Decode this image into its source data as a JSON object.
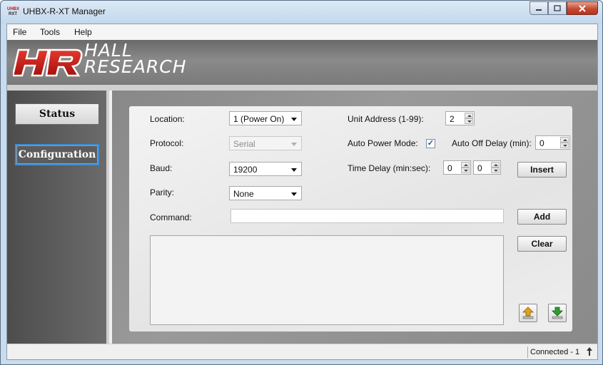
{
  "window": {
    "title": "UHBX-R-XT Manager",
    "app_icon_top": "UHBX",
    "app_icon_bottom": "RXT"
  },
  "menu": {
    "items": [
      "File",
      "Tools",
      "Help"
    ]
  },
  "banner": {
    "logo_mark": "HR",
    "brand_line1": "HALL",
    "brand_line2": "RESEARCH"
  },
  "nav": {
    "status_label": "Status",
    "configuration_label": "Configuration",
    "active": "Configuration"
  },
  "form": {
    "location_label": "Location:",
    "location_value": "1 (Power On)",
    "protocol_label": "Protocol:",
    "protocol_value": "Serial",
    "baud_label": "Baud:",
    "baud_value": "19200",
    "parity_label": "Parity:",
    "parity_value": "None",
    "unit_address_label": "Unit Address (1-99):",
    "unit_address_value": "2",
    "auto_power_label": "Auto Power Mode:",
    "auto_power_checked": true,
    "auto_off_label": "Auto Off Delay (min):",
    "auto_off_value": "0",
    "time_delay_label": "Time Delay (min:sec):",
    "time_delay_min": "0",
    "time_delay_sec": "0",
    "insert_label": "Insert",
    "command_label": "Command:",
    "command_value": "",
    "add_label": "Add",
    "clear_label": "Clear"
  },
  "colors": {
    "nav_active_border": "#3b8fd9",
    "brand_red": "#c0141b",
    "upload_icon": "#e0a21a",
    "download_icon": "#2f9d2f"
  },
  "icons": {
    "upload": "upload-arrow-icon",
    "download": "download-arrow-icon",
    "connection": "connection-icon"
  },
  "status": {
    "text": "Connected - 1"
  }
}
